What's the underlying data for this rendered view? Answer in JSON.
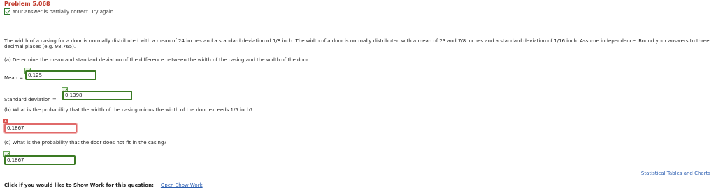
{
  "problem_title": "Problem 5.068",
  "status_text": "Your answer is partially correct.  Try again.",
  "problem_text": "The width of a casing for a door is normally distributed with a mean of 24 inches and a standard deviation of 1/8 inch. The width of a door is normally distributed with a mean of 23 and 7/8 inches and a standard deviation of 1/16 inch. Assume independence. Round your answers to three decimal places (e.g. 98.765).",
  "part_a": {
    "question": "(a) Determine the mean and standard deviation of the difference between the width of the casing and the width of the door.",
    "mean_label": "Mean =",
    "mean_value": "0.125",
    "sd_label": "Standard deviation =",
    "sd_value": "0.1398"
  },
  "part_b": {
    "question": "(b) What is the probability that the width of the casing minus the width of the door exceeds 1/5 inch?",
    "answer": "0.1867",
    "x_glyph": "x"
  },
  "part_c": {
    "question": "(c) What is the probability that the door does not fit in the casing?",
    "answer": "0.1867"
  },
  "links": {
    "tables": "Statistical Tables and Charts",
    "show_work_prompt": "Click if you would like to Show Work for this question:",
    "show_work_link": "Open Show Work"
  },
  "colors": {
    "title": "#c0392b",
    "correct_border": "#3a7a23",
    "wrong_border": "#e06a6a",
    "link": "#2a5db0"
  },
  "icons": {
    "correct_mark": "check-icon",
    "wrong_mark": "x-icon",
    "status_mark": "edit-check-icon"
  }
}
